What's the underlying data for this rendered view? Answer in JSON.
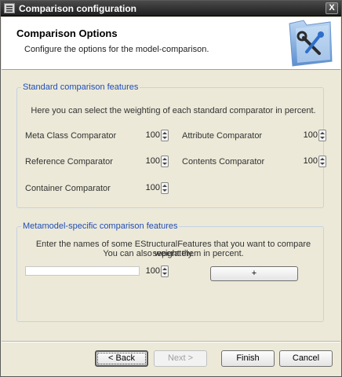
{
  "window": {
    "title": "Comparison configuration",
    "close_label": "X"
  },
  "header": {
    "title": "Comparison Options",
    "description": "Configure the options for the model-comparison.",
    "logo_icon": "folder-tools-icon"
  },
  "standard_group": {
    "label": "Standard comparison features",
    "intro": "Here you can select the weighting of each standard comparator in percent.",
    "comparators": [
      {
        "label": "Meta Class Comparator",
        "value": "100"
      },
      {
        "label": "Attribute Comparator",
        "value": "100"
      },
      {
        "label": "Reference Comparator",
        "value": "100"
      },
      {
        "label": "Contents Comparator",
        "value": "100"
      },
      {
        "label": "Container Comparator",
        "value": "100"
      }
    ]
  },
  "metamodel_group": {
    "label": "Metamodel-specific comparison features",
    "intro_line1": "Enter the names of some EStructuralFeatures that you want to compare seperately.",
    "intro_line2": "You can also weight them in percent.",
    "feature_input_value": "",
    "feature_weight": "100",
    "add_label": "+"
  },
  "buttons": {
    "back": "< Back",
    "next": "Next >",
    "finish": "Finish",
    "cancel": "Cancel"
  },
  "colors": {
    "group_label": "#1f4db6",
    "titlebar": "#2a2a2a",
    "dialog_bg": "#ece9d8"
  }
}
